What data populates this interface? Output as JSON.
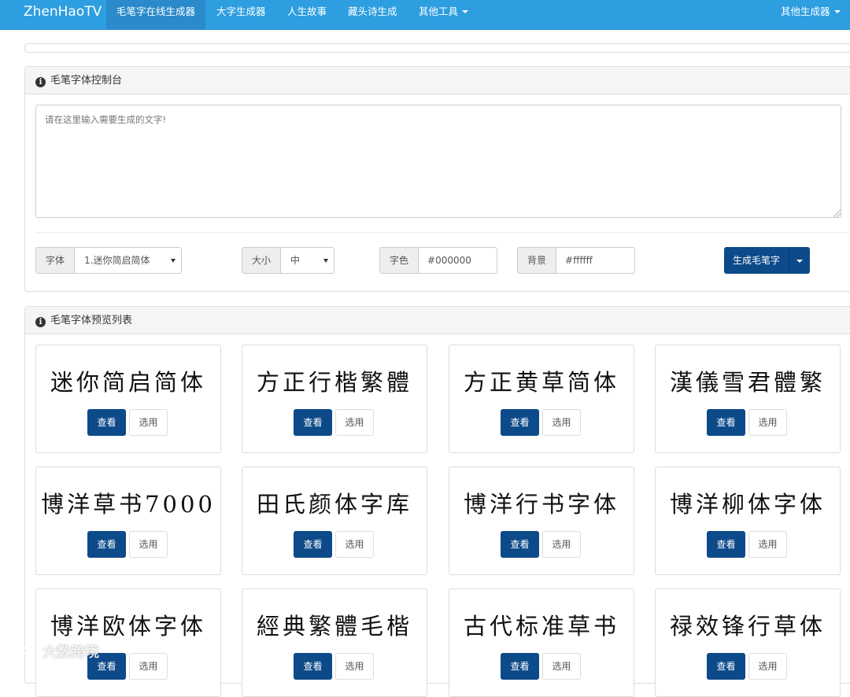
{
  "navbar": {
    "brand": "ZhenHaoTV",
    "items": [
      {
        "label": "毛笔字在线生成器",
        "active": true
      },
      {
        "label": "大字生成器"
      },
      {
        "label": "人生故事"
      },
      {
        "label": "藏头诗生成"
      },
      {
        "label": "其他工具",
        "dropdown": true
      }
    ],
    "right_menu": {
      "label": "其他生成器",
      "dropdown": true
    }
  },
  "control_panel": {
    "title": "毛笔字体控制台",
    "textarea_placeholder": "请在这里输入需要生成的文字!",
    "font": {
      "label": "字体",
      "selected": "1.迷你简启简体"
    },
    "size": {
      "label": "大小",
      "selected": "中"
    },
    "color": {
      "label": "字色",
      "value": "#000000"
    },
    "background": {
      "label": "背景",
      "value": "#ffffff"
    },
    "generate_button": "生成毛笔字"
  },
  "preview_panel": {
    "title": "毛笔字体预览列表",
    "view_label": "查看",
    "use_label": "选用",
    "fonts": [
      {
        "sample": "迷你简启简体"
      },
      {
        "sample": "方正行楷繁體"
      },
      {
        "sample": "方正黄草简体"
      },
      {
        "sample": "漢儀雪君體繁"
      },
      {
        "sample": "博洋草书7000"
      },
      {
        "sample": "田氏颜体字库"
      },
      {
        "sample": "博洋行书字体"
      },
      {
        "sample": "博洋柳体字体"
      },
      {
        "sample": "博洋欧体字体"
      },
      {
        "sample": "經典繁體毛楷"
      },
      {
        "sample": "古代标准草书"
      },
      {
        "sample": "禄效锋行草体"
      }
    ]
  },
  "watermark": "大数跨境"
}
